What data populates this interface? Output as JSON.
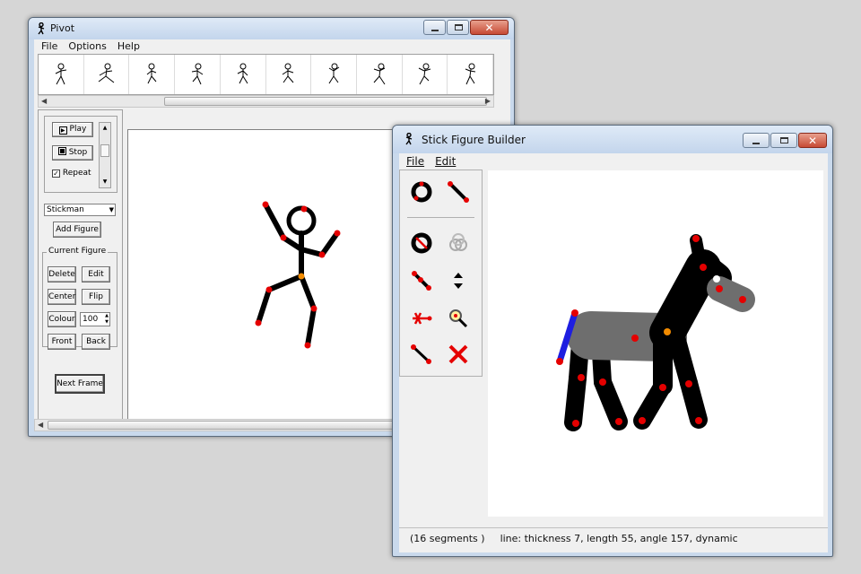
{
  "pivot": {
    "title": "Pivot",
    "menu": [
      "File",
      "Options",
      "Help"
    ],
    "controls": {
      "play": "Play",
      "stop": "Stop",
      "repeat": "Repeat",
      "repeat_checked": true,
      "figure_select": "Stickman",
      "add_figure": "Add Figure",
      "current_figure_label": "Current Figure",
      "delete": "Delete",
      "edit": "Edit",
      "center": "Center",
      "flip": "Flip",
      "colour": "Colour",
      "size_value": "100",
      "front": "Front",
      "back": "Back",
      "next_frame": "Next Frame"
    },
    "frame_count_visible": 10
  },
  "sfb": {
    "title": "Stick Figure Builder",
    "menu": [
      "File",
      "Edit"
    ],
    "tools": [
      "add-circle-icon",
      "add-line-icon",
      "circle-segment-icon",
      "joint-merge-icon",
      "split-segment-icon",
      "arrange-updown-icon",
      "delete-joint-icon",
      "zoom-icon",
      "line-end-icon",
      "delete-icon"
    ],
    "status_segments": "(16 segments )",
    "status_line": "line: thickness 7, length 55, angle 157, dynamic"
  },
  "colors": {
    "joint_red": "#e50000",
    "joint_orange": "#f28b00",
    "selected_blue": "#1e1ee0",
    "body_gray": "#6e6e6e"
  }
}
